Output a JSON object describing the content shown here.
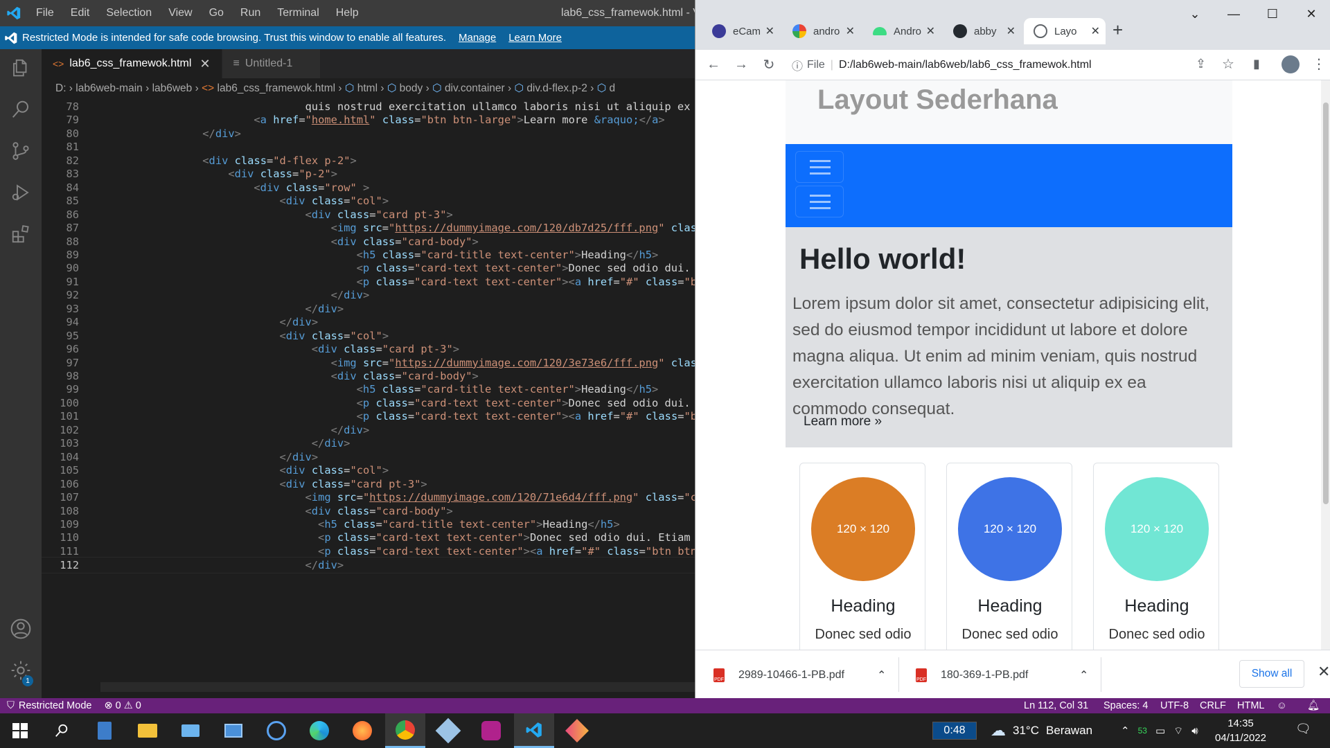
{
  "vscode": {
    "menu": [
      "File",
      "Edit",
      "Selection",
      "View",
      "Go",
      "Run",
      "Terminal",
      "Help"
    ],
    "window_title": "lab6_css_framewok.html - Vis",
    "banner": {
      "text": "Restricted Mode is intended for safe code browsing. Trust this window to enable all features.",
      "manage": "Manage",
      "learn_more": "Learn More"
    },
    "tabs": [
      {
        "label": "lab6_css_framewok.html",
        "active": true
      },
      {
        "label": "Untitled-1",
        "active": false
      }
    ],
    "breadcrumb": [
      "D:",
      "lab6web-main",
      "lab6web",
      "lab6_css_framewok.html",
      "html",
      "body",
      "div.container",
      "div.d-flex.p-2",
      "d"
    ],
    "code_lines": [
      {
        "n": "78",
        "t": "                                quis nostrud exercitation ullamco laboris nisi ut aliquip ex"
      },
      {
        "n": "79",
        "t": "                        <a href=\"home.html\" class=\"btn btn-large\">Learn more &raquo;</a>"
      },
      {
        "n": "80",
        "t": "                </div>"
      },
      {
        "n": "81",
        "t": ""
      },
      {
        "n": "82",
        "t": "                <div class=\"d-flex p-2\">"
      },
      {
        "n": "83",
        "t": "                    <div class=\"p-2\">"
      },
      {
        "n": "84",
        "t": "                        <div class=\"row\" >"
      },
      {
        "n": "85",
        "t": "                            <div class=\"col\">"
      },
      {
        "n": "86",
        "t": "                                <div class=\"card pt-3\">"
      },
      {
        "n": "87",
        "t": "                                    <img src=\"https://dummyimage.com/120/db7d25/fff.png\" class=\"c"
      },
      {
        "n": "88",
        "t": "                                    <div class=\"card-body\">"
      },
      {
        "n": "89",
        "t": "                                        <h5 class=\"card-title text-center\">Heading</h5>"
      },
      {
        "n": "90",
        "t": "                                        <p class=\"card-text text-center\">Donec sed odio dui. Etia"
      },
      {
        "n": "91",
        "t": "                                        <p class=\"card-text text-center\"><a href=\"#\" class=\"btn b"
      },
      {
        "n": "92",
        "t": "                                    </div>"
      },
      {
        "n": "93",
        "t": "                                </div>"
      },
      {
        "n": "94",
        "t": "                            </div>"
      },
      {
        "n": "95",
        "t": "                            <div class=\"col\">"
      },
      {
        "n": "96",
        "t": "                                 <div class=\"card pt-3\">"
      },
      {
        "n": "97",
        "t": "                                    <img src=\"https://dummyimage.com/120/3e73e6/fff.png\" class=\"c"
      },
      {
        "n": "98",
        "t": "                                    <div class=\"card-body\">"
      },
      {
        "n": "99",
        "t": "                                        <h5 class=\"card-title text-center\">Heading</h5>"
      },
      {
        "n": "100",
        "t": "                                        <p class=\"card-text text-center\">Donec sed odio dui. Etia"
      },
      {
        "n": "101",
        "t": "                                        <p class=\"card-text text-center\"><a href=\"#\" class=\"btn b"
      },
      {
        "n": "102",
        "t": "                                    </div>"
      },
      {
        "n": "103",
        "t": "                                 </div>"
      },
      {
        "n": "104",
        "t": "                            </div>"
      },
      {
        "n": "105",
        "t": "                            <div class=\"col\">"
      },
      {
        "n": "106",
        "t": "                            <div class=\"card pt-3\">"
      },
      {
        "n": "107",
        "t": "                                <img src=\"https://dummyimage.com/120/71e6d4/fff.png\" class=\"card-"
      },
      {
        "n": "108",
        "t": "                                <div class=\"card-body\">"
      },
      {
        "n": "109",
        "t": "                                  <h5 class=\"card-title text-center\">Heading</h5>"
      },
      {
        "n": "110",
        "t": "                                  <p class=\"card-text text-center\">Donec sed odio dui. Etiam port"
      },
      {
        "n": "111",
        "t": "                                  <p class=\"card-text text-center\"><a href=\"#\" class=\"btn btn-sec"
      },
      {
        "n": "112",
        "t": "                                </div>"
      }
    ],
    "status_bar": {
      "restricted": "Restricted Mode",
      "errors": "0",
      "warnings": "0"
    }
  },
  "chrome": {
    "tabs": [
      {
        "label": "eCam",
        "icon": "ecampus-icon",
        "color": "#3b3b98"
      },
      {
        "label": "andro",
        "icon": "google-icon",
        "color": "#4285f4"
      },
      {
        "label": "Andro",
        "icon": "android-icon",
        "color": "#3ddc84"
      },
      {
        "label": "abby",
        "icon": "github-icon",
        "color": "#24292f"
      },
      {
        "label": "Layo",
        "icon": "globe-icon",
        "color": "#5f6368",
        "active": true
      }
    ],
    "address": {
      "scheme": "File",
      "url": "D:/lab6web-main/lab6web/lab6_css_framewok.html"
    },
    "page": {
      "header_title": "Layout Sederhana",
      "jumbo_title": "Hello world!",
      "jumbo_text": "Lorem ipsum dolor sit amet, consectetur adipisicing elit, sed do eiusmod tempor incididunt ut labore et dolore magna aliqua. Ut enim ad minim veniam, quis nostrud exercitation ullamco laboris nisi ut aliquip ex ea commodo consequat.",
      "learn_more": "Learn more »",
      "cards": [
        {
          "img_text": "120 × 120",
          "color": "#db7d25",
          "heading": "Heading",
          "text": "Donec sed odio"
        },
        {
          "img_text": "120 × 120",
          "color": "#3e73e6",
          "heading": "Heading",
          "text": "Donec sed odio"
        },
        {
          "img_text": "120 × 120",
          "color": "#71e6d4",
          "heading": "Heading",
          "text": "Donec sed odio"
        }
      ]
    },
    "downloads": [
      {
        "name": "2989-10466-1-PB.pdf"
      },
      {
        "name": "180-369-1-PB.pdf"
      }
    ],
    "show_all": "Show all",
    "status_right": {
      "position": "Ln 112, Col 31",
      "spaces": "Spaces: 4",
      "encoding": "UTF-8",
      "eol": "CRLF",
      "language": "HTML"
    }
  },
  "taskbar": {
    "timer": "0:48",
    "weather": {
      "temp": "31°C",
      "desc": "Berawan"
    },
    "tray_badge": "53",
    "time": "14:35",
    "date": "04/11/2022"
  }
}
